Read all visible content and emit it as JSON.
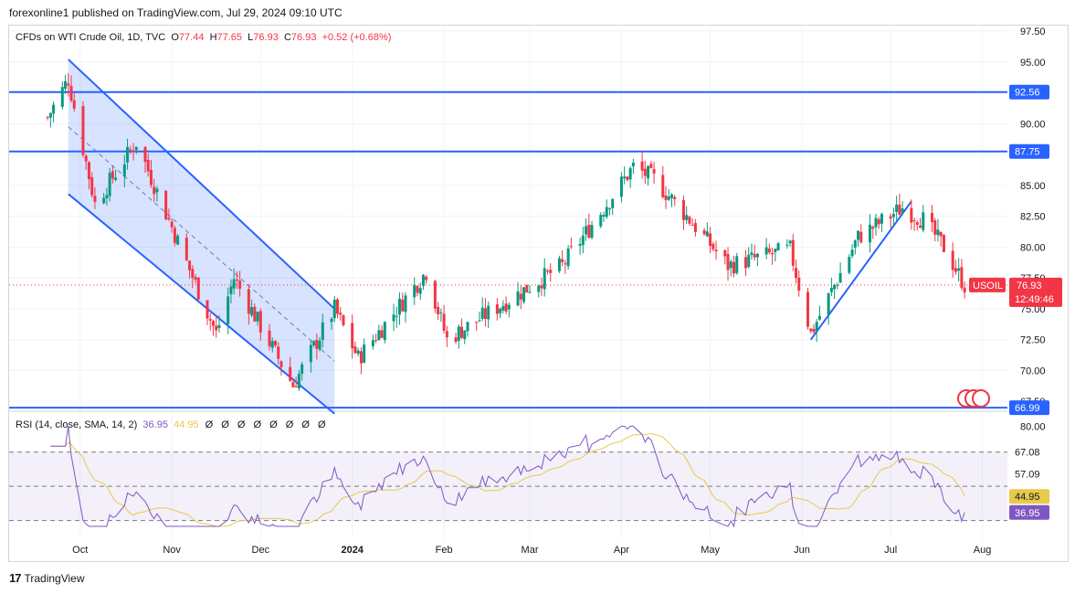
{
  "header": {
    "text": "forexonline1 published on TradingView.com, Jul 29, 2024 09:10 UTC"
  },
  "legend": {
    "symbol": "CFDs on WTI Crude Oil, 1D, TVC",
    "o_label": "O",
    "o": "77.44",
    "h_label": "H",
    "h": "77.65",
    "l_label": "L",
    "l": "76.93",
    "c_label": "C",
    "c": "76.93",
    "chg": "+0.52 (+0.68%)"
  },
  "rsi_legend": {
    "text": "RSI (14, close, SMA, 14, 2)",
    "rsi": "36.95",
    "sma": "44.95",
    "eyes": "Ø Ø Ø Ø Ø Ø Ø Ø"
  },
  "footer": {
    "brand": "TradingView",
    "logo": "17"
  },
  "colors": {
    "up": "#089981",
    "down": "#f23645",
    "level": "#2962ff",
    "channel": "#2962ff",
    "rsi": "#7e57c2",
    "rsi_sma": "#e8c94b"
  },
  "chart_data": {
    "type": "candlestick",
    "title": "CFDs on WTI Crude Oil, 1D, TVC",
    "symbol": "USOIL",
    "price_axis_ticks": [
      "97.50",
      "95.00",
      "92.50",
      "90.00",
      "87.50",
      "85.00",
      "82.50",
      "80.00",
      "77.50",
      "75.00",
      "72.50",
      "70.00",
      "67.50"
    ],
    "time_axis_ticks": [
      "Oct",
      "Nov",
      "Dec",
      "2024",
      "Feb",
      "Mar",
      "Apr",
      "May",
      "Jun",
      "Jul",
      "Aug"
    ],
    "ylim": [
      67.0,
      97.5
    ],
    "horizontal_levels": [
      {
        "value": 92.56,
        "label": "92.56"
      },
      {
        "value": 87.75,
        "label": "87.75"
      },
      {
        "value": 66.99,
        "label": "66.99"
      }
    ],
    "last_price": {
      "label": "USOIL",
      "value": "76.93",
      "countdown": "12:49:46"
    },
    "anchor_closes": [
      {
        "date": "2023-09-20",
        "price": 90.5
      },
      {
        "date": "2023-09-27",
        "price": 93.6
      },
      {
        "date": "2023-10-06",
        "price": 83.5
      },
      {
        "date": "2023-10-20",
        "price": 88.5
      },
      {
        "date": "2023-11-16",
        "price": 73.0
      },
      {
        "date": "2023-11-22",
        "price": 77.5
      },
      {
        "date": "2023-12-12",
        "price": 68.8
      },
      {
        "date": "2023-12-26",
        "price": 75.0
      },
      {
        "date": "2024-01-03",
        "price": 71.0
      },
      {
        "date": "2024-01-26",
        "price": 78.0
      },
      {
        "date": "2024-02-02",
        "price": 72.5
      },
      {
        "date": "2024-03-12",
        "price": 78.5
      },
      {
        "date": "2024-04-05",
        "price": 86.5
      },
      {
        "date": "2024-04-12",
        "price": 85.5
      },
      {
        "date": "2024-04-22",
        "price": 82.8
      },
      {
        "date": "2024-05-07",
        "price": 78.5
      },
      {
        "date": "2024-05-28",
        "price": 79.8
      },
      {
        "date": "2024-06-04",
        "price": 73.0
      },
      {
        "date": "2024-06-20",
        "price": 80.8
      },
      {
        "date": "2024-07-05",
        "price": 83.2
      },
      {
        "date": "2024-07-12",
        "price": 82.2
      },
      {
        "date": "2024-07-19",
        "price": 80.0
      },
      {
        "date": "2024-07-26",
        "price": 76.9
      }
    ],
    "drawings": {
      "down_channel": {
        "upper": [
          [
            "2023-09-27",
            95.2
          ],
          [
            "2023-12-26",
            75.0
          ]
        ],
        "lower": [
          [
            "2023-09-27",
            84.3
          ],
          [
            "2023-12-26",
            66.5
          ]
        ]
      },
      "uptrend_line": [
        [
          "2024-06-04",
          72.5
        ],
        [
          "2024-07-08",
          83.7
        ]
      ]
    },
    "rsi": {
      "name": "RSI (14, close, SMA, 14, 2)",
      "value": 36.95,
      "sma": 44.95,
      "axis_ticks": [
        "80.00"
      ],
      "bands": [
        {
          "value": 67.08,
          "label": "67.08"
        },
        {
          "value": 57.09,
          "label": "57.09"
        },
        {
          "value": 44.95,
          "label": "44.95"
        },
        {
          "value": 36.95,
          "label": "36.95"
        }
      ],
      "ylim": [
        30,
        82
      ]
    }
  }
}
